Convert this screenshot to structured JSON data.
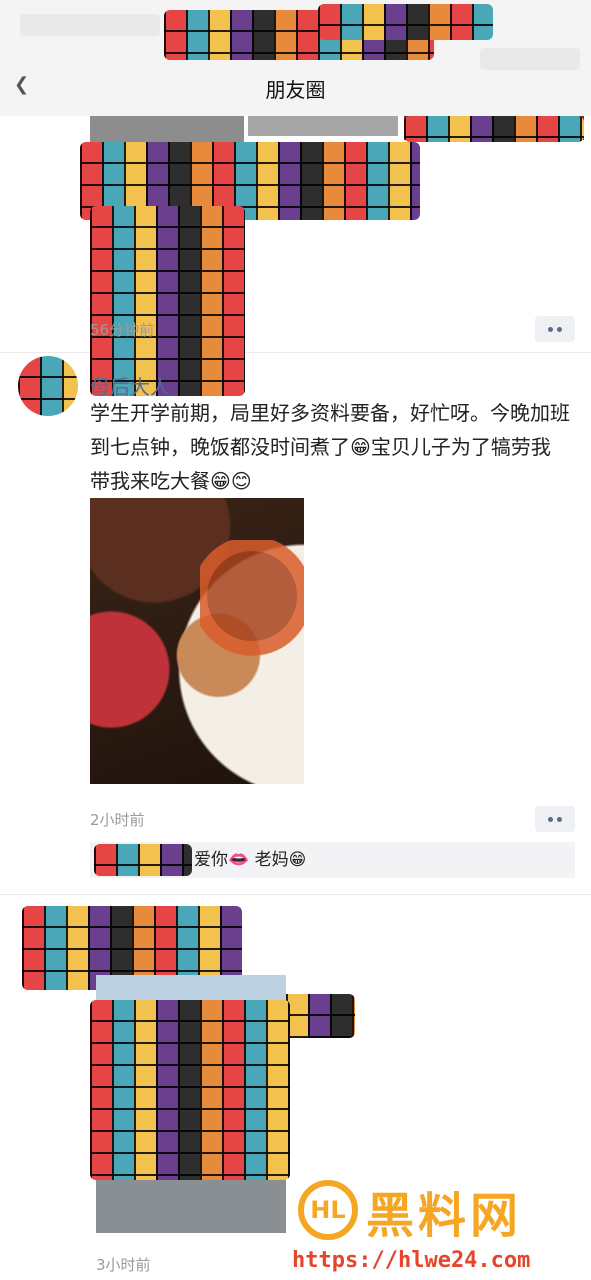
{
  "header": {
    "title": "朋友圈"
  },
  "posts": [
    {
      "time": "56分钟前"
    },
    {
      "author": "母后大人",
      "text": "学生开学前期，局里好多资料要备，好忙呀。今晚加班到七点钟，晚饭都没时间煮了😁宝贝儿子为了犒劳我带我来吃大餐😁😊",
      "time": "2小时前",
      "comment": "爱你👄 老妈😁"
    },
    {
      "time": "3小时前"
    }
  ],
  "watermark": {
    "title": "黑料网",
    "logo_text": "HL",
    "url": "https://hlwe24.com"
  }
}
